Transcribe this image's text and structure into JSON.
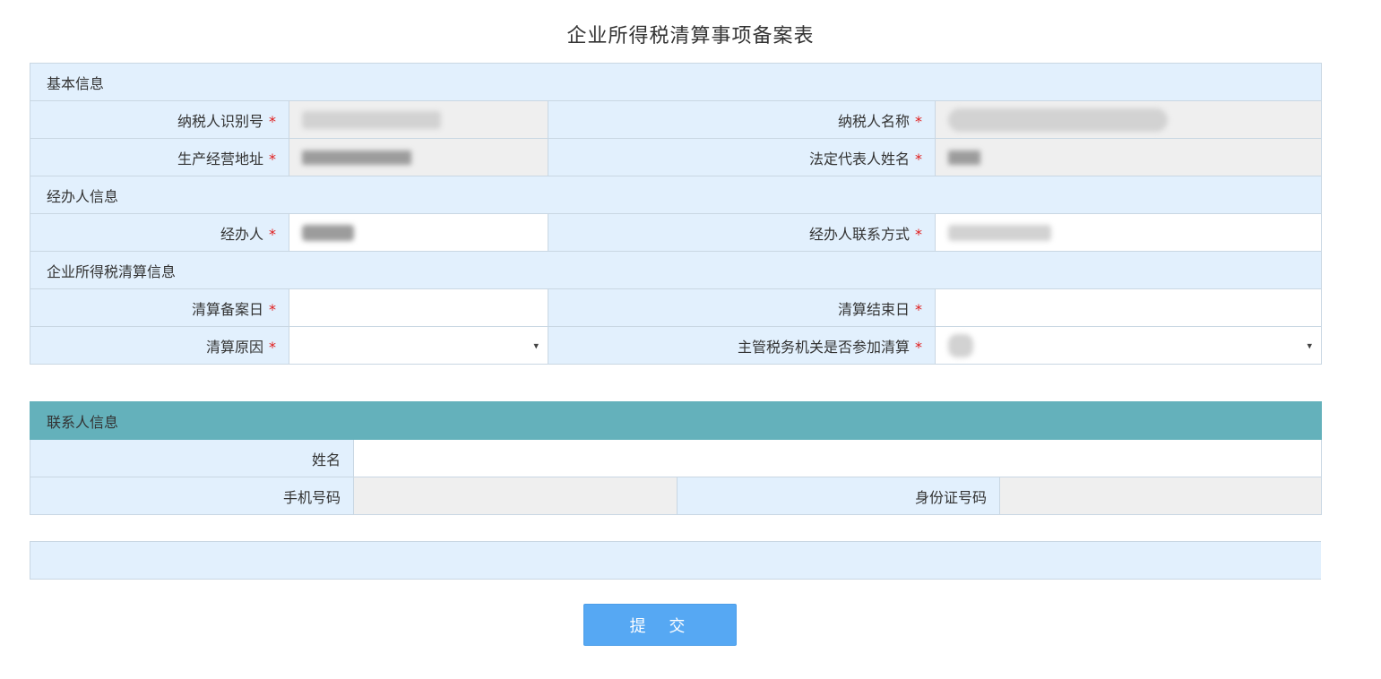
{
  "page": {
    "title": "企业所得税清算事项备案表"
  },
  "sections": {
    "basic": "基本信息",
    "handler": "经办人信息",
    "settlement": "企业所得税清算信息",
    "contact": "联系人信息"
  },
  "fields": {
    "taxpayer_id_label": "纳税人识别号",
    "taxpayer_name_label": "纳税人名称",
    "address_label": "生产经营地址",
    "legal_rep_label": "法定代表人姓名",
    "handler_label": "经办人",
    "handler_contact_label": "经办人联系方式",
    "filing_date_label": "清算备案日",
    "end_date_label": "清算结束日",
    "reason_label": "清算原因",
    "tax_authority_label": "主管税务机关是否参加清算",
    "required_mark": "*"
  },
  "contact": {
    "name_label": "姓名",
    "phone_label": "手机号码",
    "id_label": "身份证号码"
  },
  "actions": {
    "submit_label": "提 交"
  },
  "icons": {
    "select_caret": "▾"
  },
  "colors": {
    "section_bg": "#e2f0fd",
    "contact_header_bg": "#64b1bb",
    "readonly_bg": "#efefef",
    "required": "#e01c1c",
    "submit_bg": "#56a8f3"
  }
}
